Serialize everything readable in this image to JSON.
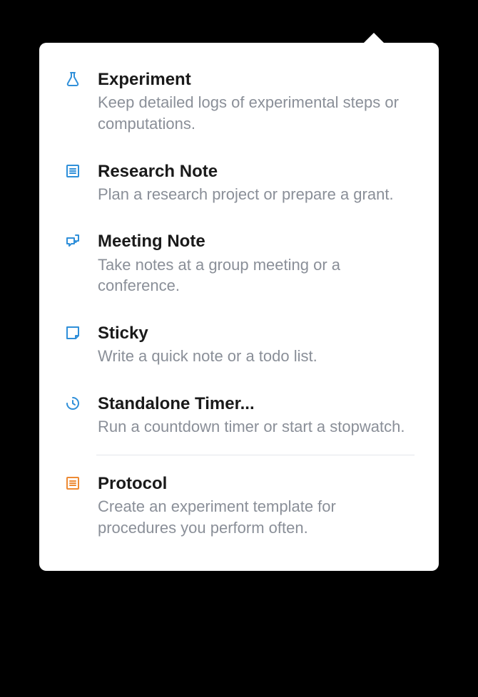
{
  "menu": {
    "items": [
      {
        "icon": "flask-icon",
        "title": "Experiment",
        "desc": "Keep detailed logs of experimental steps or computations."
      },
      {
        "icon": "lines-icon",
        "title": "Research Note",
        "desc": "Plan a research project or prepare a grant."
      },
      {
        "icon": "chat-icon",
        "title": "Meeting Note",
        "desc": "Take notes at a group meeting or a conference."
      },
      {
        "icon": "sticky-icon",
        "title": "Sticky",
        "desc": "Write a quick note or a todo list."
      },
      {
        "icon": "timer-icon",
        "title": "Standalone Timer...",
        "desc": "Run a countdown timer or start a stopwatch."
      },
      {
        "icon": "protocol-icon",
        "title": "Protocol",
        "desc": "Create an experiment template for procedures you perform often."
      }
    ]
  }
}
